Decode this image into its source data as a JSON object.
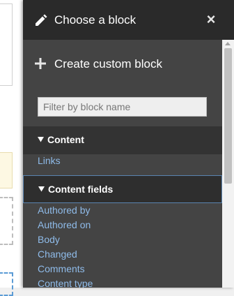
{
  "dialog": {
    "title": "Choose a block",
    "close_label": "×",
    "create_custom_block": "Create custom block",
    "filter": {
      "placeholder": "Filter by block name",
      "value": ""
    }
  },
  "sections": [
    {
      "label": "Content",
      "links": [
        "Links"
      ]
    },
    {
      "label": "Content fields",
      "links": [
        "Authored by",
        "Authored on",
        "Body",
        "Changed",
        "Comments",
        "Content type"
      ]
    }
  ],
  "icons": {
    "title": "pencil-icon",
    "create": "plus-icon",
    "section": "triangle-down-icon",
    "close": "close-icon"
  },
  "colors": {
    "link": "#8fbbe9",
    "titlebar": "#2a2a2a",
    "panel": "#444444",
    "section_header": "#333333",
    "active_border": "#5a84b0"
  }
}
